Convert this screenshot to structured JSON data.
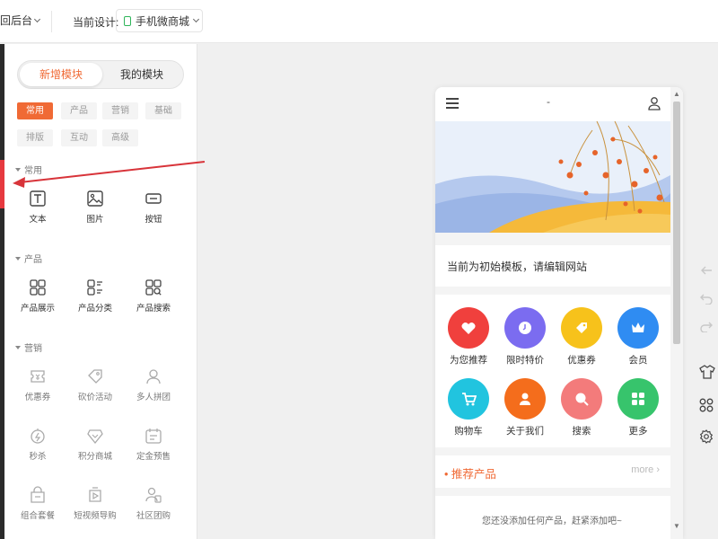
{
  "header": {
    "back_label": "回后台",
    "current_design_label": "当前设计:",
    "design_name": "手机微商城"
  },
  "panel": {
    "tabs": [
      {
        "label": "新增模块"
      },
      {
        "label": "我的模块"
      }
    ],
    "chips": [
      "常用",
      "产品",
      "营销",
      "基础",
      "排版",
      "互动",
      "高级"
    ],
    "sections": [
      {
        "title": "常用",
        "items": [
          {
            "label": "文本",
            "icon": "text-icon"
          },
          {
            "label": "图片",
            "icon": "image-icon"
          },
          {
            "label": "按钮",
            "icon": "button-icon"
          }
        ]
      },
      {
        "title": "产品",
        "items": [
          {
            "label": "产品展示",
            "icon": "grid-icon"
          },
          {
            "label": "产品分类",
            "icon": "category-icon"
          },
          {
            "label": "产品搜索",
            "icon": "search-grid-icon"
          }
        ]
      },
      {
        "title": "营销",
        "items": [
          {
            "label": "优惠券",
            "icon": "coupon-icon"
          },
          {
            "label": "砍价活动",
            "icon": "bargain-icon"
          },
          {
            "label": "多人拼团",
            "icon": "group-buy-icon"
          },
          {
            "label": "秒杀",
            "icon": "flash-sale-icon"
          },
          {
            "label": "积分商城",
            "icon": "points-mall-icon"
          },
          {
            "label": "定金预售",
            "icon": "presale-icon"
          },
          {
            "label": "组合套餐",
            "icon": "bundle-icon"
          },
          {
            "label": "短视频导购",
            "icon": "video-guide-icon"
          },
          {
            "label": "社区团购",
            "icon": "community-group-icon"
          }
        ]
      }
    ]
  },
  "preview": {
    "page_title": "-",
    "notice": "当前为初始模板，请编辑网站",
    "nav_items": [
      {
        "label": "为您推荐",
        "color": "#f0403d",
        "icon": "heart-icon"
      },
      {
        "label": "限时特价",
        "color": "#7b6cf0",
        "icon": "clock-icon"
      },
      {
        "label": "优惠券",
        "color": "#f7c21b",
        "icon": "tag-icon"
      },
      {
        "label": "会员",
        "color": "#2f8cf2",
        "icon": "crown-icon"
      },
      {
        "label": "购物车",
        "color": "#21c4df",
        "icon": "cart-icon"
      },
      {
        "label": "关于我们",
        "color": "#f46d1c",
        "icon": "people-icon"
      },
      {
        "label": "搜索",
        "color": "#f37b7b",
        "icon": "search-icon"
      },
      {
        "label": "更多",
        "color": "#37c46c",
        "icon": "more-grid-icon"
      }
    ],
    "recommend_title": "推荐产品",
    "more_label": "more",
    "empty_text": "您还没添加任何产品，赶紧添加吧~"
  }
}
